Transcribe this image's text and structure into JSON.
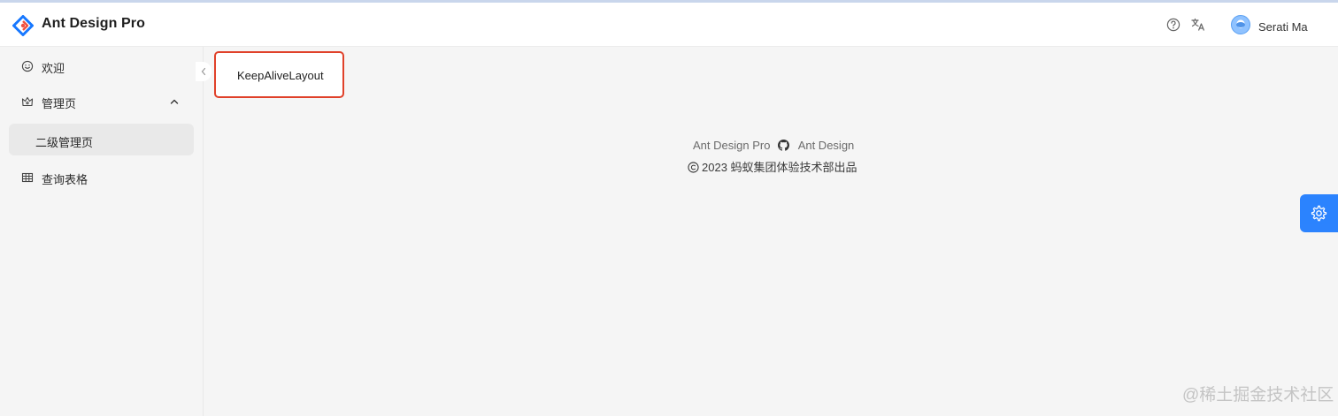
{
  "header": {
    "app_title": "Ant Design Pro",
    "logo_icon": "ant-design-diamond-logo",
    "help_icon": "question-circle-icon",
    "translate_icon": "translation-icon",
    "user_name": "Serati Ma",
    "accent_color": "#1677ff"
  },
  "sidebar": {
    "items": [
      {
        "label": "欢迎",
        "icon": "smile-icon"
      },
      {
        "label": "管理页",
        "icon": "crown-icon",
        "expanded": true
      },
      {
        "label": "二级管理页",
        "selected": true
      },
      {
        "label": "查询表格",
        "icon": "table-icon"
      }
    ]
  },
  "tabs": {
    "active": "KeepAliveLayout",
    "highlight_color": "#e0412a"
  },
  "footer": {
    "link_pro": "Ant Design Pro",
    "link_ant": "Ant Design",
    "copyright": "2023 蚂蚁集团体验技术部出品"
  },
  "watermark": "@稀土掘金技术社区"
}
